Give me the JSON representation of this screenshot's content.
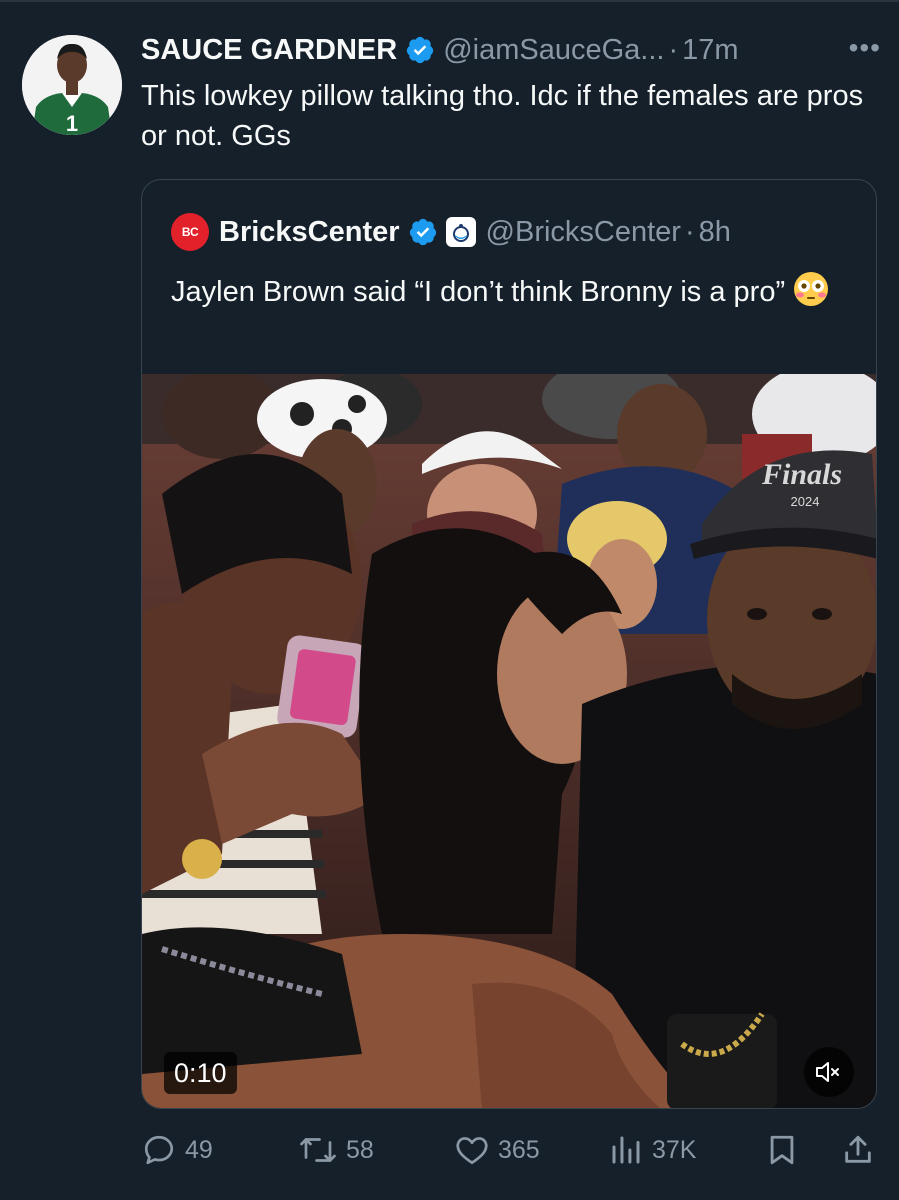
{
  "tweet": {
    "author_name": "SAUCE GARDNER",
    "handle": "@iamSauceGa...",
    "separator": "·",
    "time": "17m",
    "more": "•••",
    "text": "This lowkey pillow talking tho. Idc if the females are pros or not. GGs"
  },
  "quoted": {
    "logo_text": "BC",
    "author_name": "BricksCenter",
    "handle": "@BricksCenter",
    "separator": "·",
    "time": "8h",
    "text": "Jaylen Brown said “I don’t think Bronny is a pro”",
    "emoji_icon": "flushed-face-icon",
    "video": {
      "duration": "0:10",
      "cap_text": "Finals",
      "cap_year": "2024"
    }
  },
  "actions": {
    "replies": "49",
    "reposts": "58",
    "likes": "365",
    "views": "37K"
  },
  "colors": {
    "background": "#15202b",
    "text": "#f7f9f9",
    "muted": "#8b98a5",
    "verified": "#1d9bf0",
    "border": "#38444d"
  }
}
